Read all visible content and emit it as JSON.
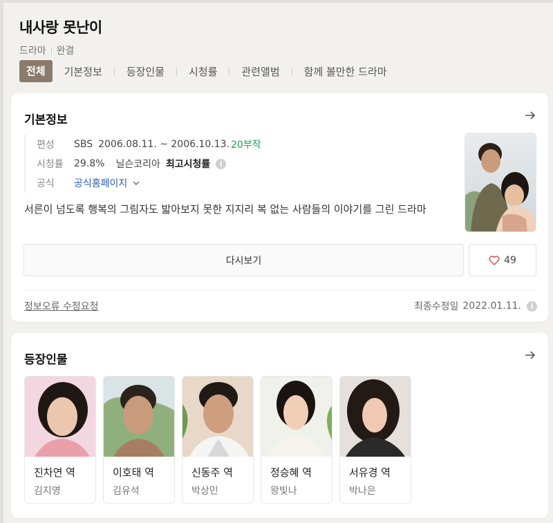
{
  "header": {
    "title": "내사랑 못난이",
    "genre": "드라마",
    "status": "완결"
  },
  "tabs": [
    {
      "label": "전체",
      "active": true
    },
    {
      "label": "기본정보"
    },
    {
      "label": "등장인물"
    },
    {
      "label": "시청률"
    },
    {
      "label": "관련앨범"
    },
    {
      "label": "함께 볼만한 드라마"
    }
  ],
  "basic_info": {
    "title": "기본정보",
    "broadcast": {
      "label": "편성",
      "channel": "SBS",
      "dates": "2006.08.11. ~ 2006.10.13.",
      "episodes": "20부작"
    },
    "rating": {
      "label": "시청률",
      "value": "29.8%",
      "source": "닐슨코리아",
      "type": "최고시청률"
    },
    "official": {
      "label": "공식",
      "link": "공식홈페이지"
    },
    "description": "서른이 넘도록 행복의 그림자도 밟아보지 못한 지지리 복 없는 사람들의 이야기를 그린 드라마",
    "replay_label": "다시보기",
    "like_count": "49",
    "report_label": "정보오류 수정요청",
    "updated_label": "최종수정일",
    "updated_date": "2022.01.11."
  },
  "cast_section": {
    "title": "등장인물",
    "members": [
      {
        "role": "진차연 역",
        "actor": "김지영"
      },
      {
        "role": "이호태 역",
        "actor": "김유석"
      },
      {
        "role": "신동주 역",
        "actor": "박상민"
      },
      {
        "role": "정승혜 역",
        "actor": "왕빛나"
      },
      {
        "role": "서유경 역",
        "actor": "박나은"
      }
    ]
  },
  "colors": {
    "active_tab": "#8b7b6d",
    "link_blue": "#2a5db0",
    "episodes_green": "#1aa34a",
    "rating_red": "#d24b4b"
  }
}
